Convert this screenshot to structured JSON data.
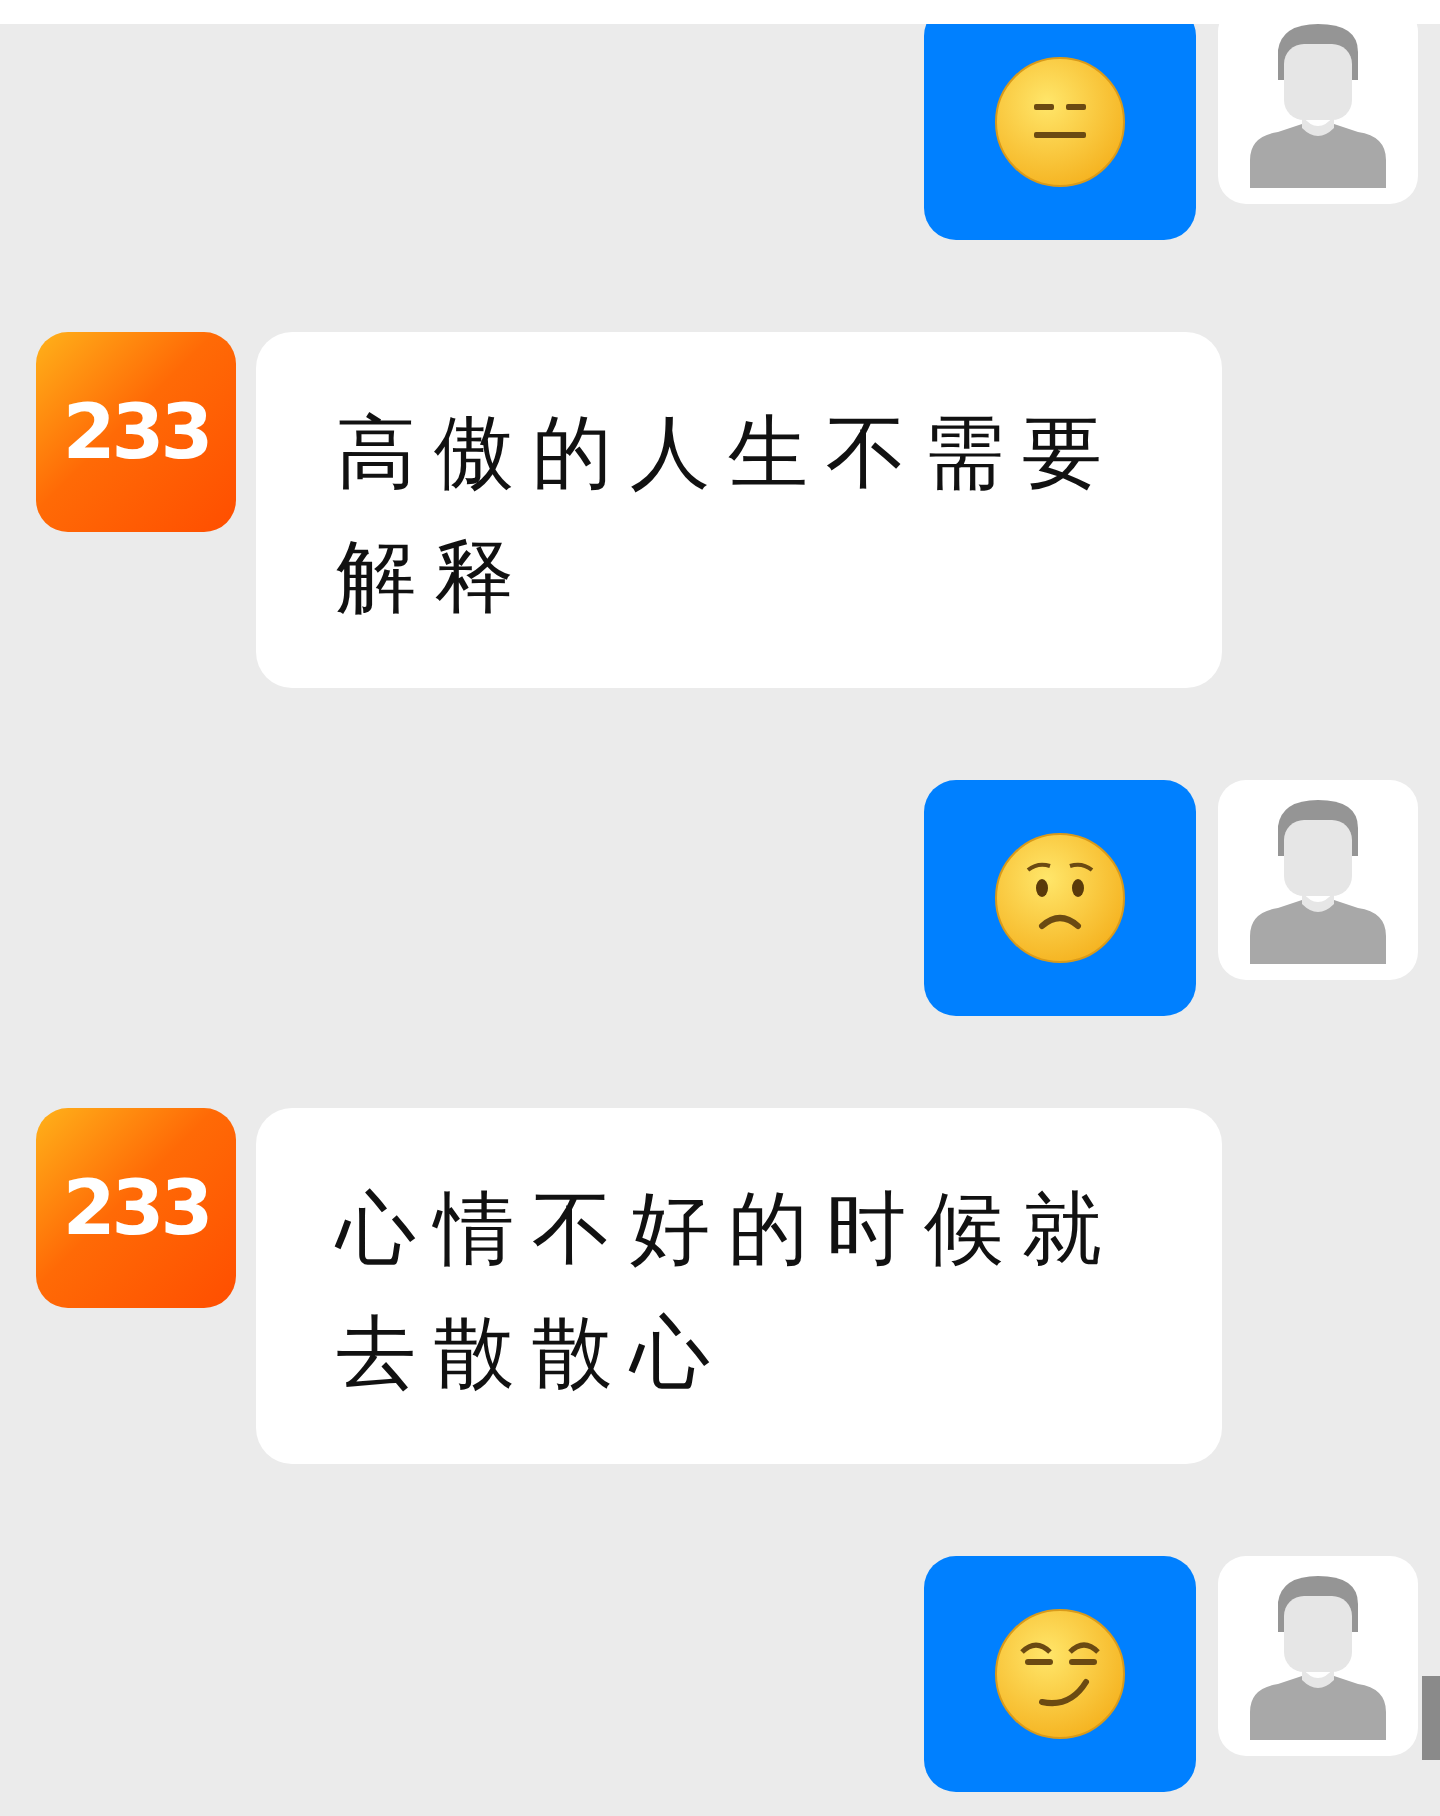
{
  "messages": [
    {
      "outgoing": true,
      "kind": "expressionless"
    },
    {
      "outgoing": false,
      "avatar": "233",
      "text": "高傲的人生不需要解释"
    },
    {
      "outgoing": true,
      "kind": "worried"
    },
    {
      "outgoing": false,
      "avatar": "233",
      "text": "心情不好的时候就去散散心"
    },
    {
      "outgoing": true,
      "kind": "smirk"
    }
  ]
}
